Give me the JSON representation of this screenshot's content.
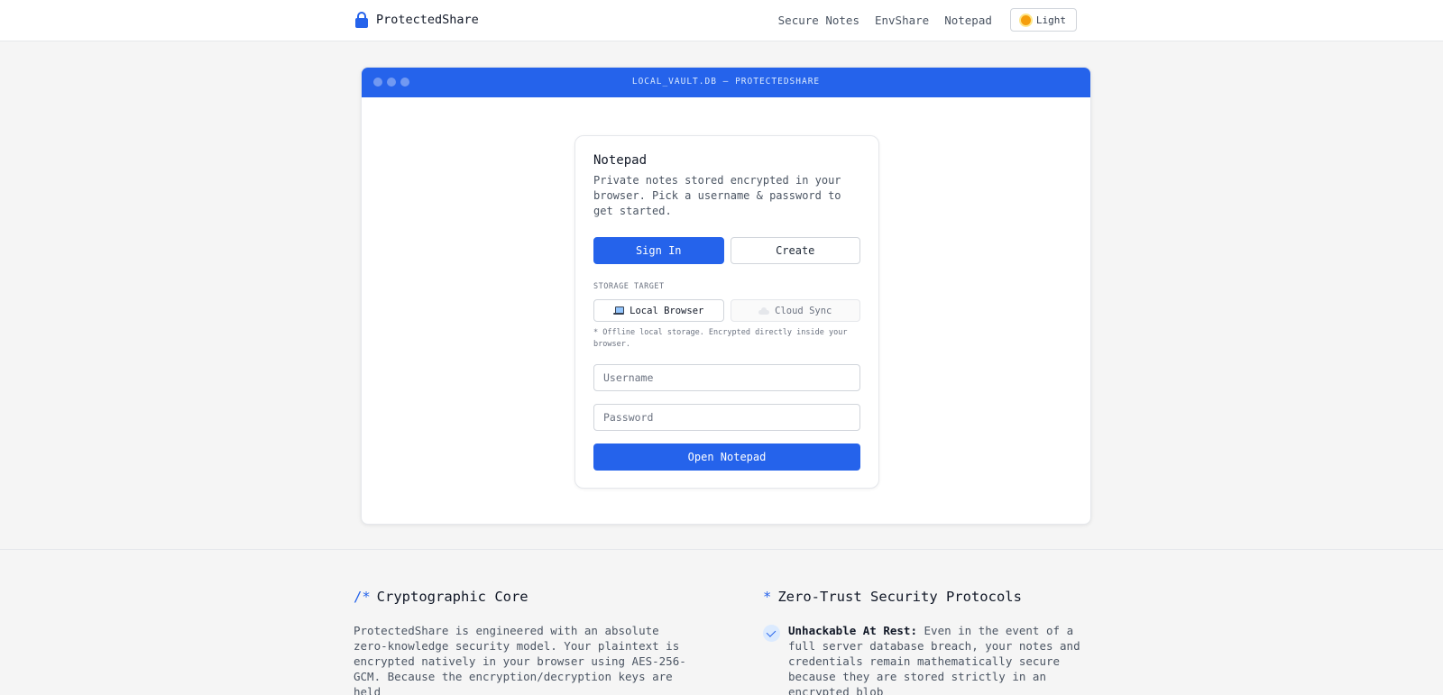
{
  "header": {
    "brand": "ProtectedShare",
    "nav": [
      "Secure Notes",
      "EnvShare",
      "Notepad"
    ],
    "theme_label": "Light"
  },
  "window": {
    "title": "LOCAL_VAULT.DB — PROTECTEDSHARE"
  },
  "card": {
    "title": "Notepad",
    "description": "Private notes stored encrypted in your browser. Pick a username & password to get started.",
    "tab_signin": "Sign In",
    "tab_create": "Create",
    "storage_label": "STORAGE TARGET",
    "storage_local": "Local Browser",
    "storage_cloud": "Cloud Sync",
    "storage_hint": "* Offline local storage. Encrypted directly inside your browser.",
    "username_placeholder": "Username",
    "password_placeholder": "Password",
    "submit": "Open Notepad"
  },
  "lower": {
    "left": {
      "prefix": "/*",
      "title": "Cryptographic Core",
      "body": "ProtectedShare is engineered with an absolute zero-knowledge security model. Your plaintext is encrypted natively in your browser using AES-256-GCM. Because the encryption/decryption keys are held"
    },
    "right": {
      "prefix": "*",
      "title": "Zero-Trust Security Protocols",
      "feature_title": "Unhackable At Rest:",
      "feature_text": " Even in the event of a full server database breach, your notes and credentials remain mathematically secure because they are stored strictly in an encrypted blob"
    }
  },
  "colors": {
    "accent": "#2563eb",
    "background": "#f5f5f5"
  },
  "icons": {
    "brand": "lock-icon",
    "theme": "sun-icon",
    "local": "laptop-icon",
    "cloud": "cloud-icon",
    "feature": "check-icon"
  }
}
